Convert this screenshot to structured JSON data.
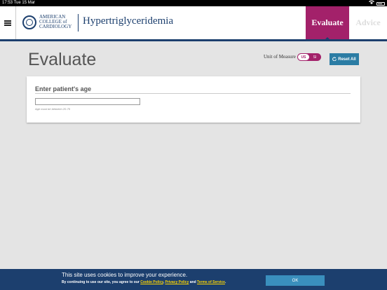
{
  "status_bar": {
    "time": "17:53",
    "date": "Tue 15 Mar"
  },
  "header": {
    "logo_lines": [
      "AMERICAN",
      "COLLEGE of",
      "CARDIOLOGY"
    ],
    "title": "Hypertriglyceridemia",
    "tabs": [
      {
        "label": "Evaluate",
        "active": true
      },
      {
        "label": "Advice",
        "active": false
      }
    ],
    "menu_icon": "hamburger-icon",
    "accent_color": "#a3216a",
    "brand_color": "#1c3f6e"
  },
  "main": {
    "page_title": "Evaluate",
    "unit_of_measure": {
      "label": "Unit of Measure",
      "options": [
        "US",
        "SI"
      ],
      "selected": "US"
    },
    "reset_button": {
      "label": "Reset All",
      "icon": "refresh-icon"
    }
  },
  "age_card": {
    "title": "Enter patient's age",
    "input_value": "",
    "help": "Age must be between 20-75"
  },
  "cookie_banner": {
    "line1": "This site uses cookies to improve your experience.",
    "prefix": "By continuing to use our site, you agree to our",
    "links": [
      "Cookie Policy",
      "Privacy Policy",
      "Terms of Service"
    ],
    "sep1": ",",
    "sep2": "and",
    "suffix": ".",
    "ok_label": "OK"
  }
}
